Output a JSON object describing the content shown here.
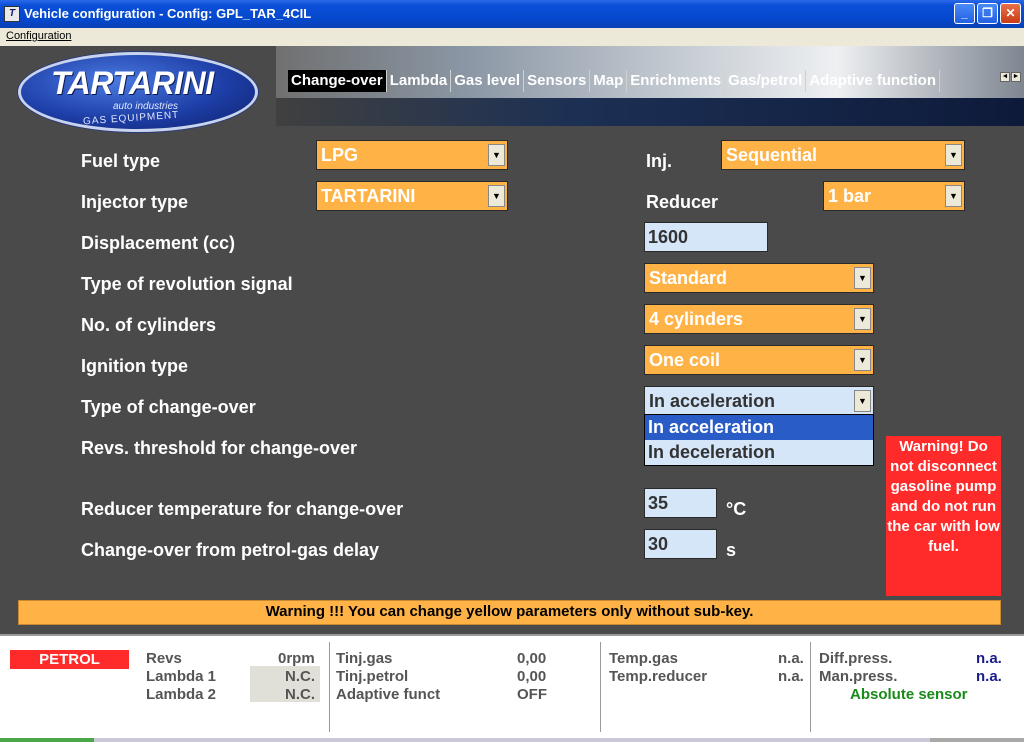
{
  "window": {
    "title": "Vehicle configuration - Config: GPL_TAR_4CIL",
    "app_icon": "tartarini-icon",
    "min_glyph": "_",
    "max_glyph": "❐",
    "close_glyph": "✕"
  },
  "menu": {
    "configuration": "Configuration"
  },
  "logo": {
    "brand": "TARTARINI",
    "sub1": "auto industries",
    "sub2": "GAS EQUIPMENT"
  },
  "tabs": [
    {
      "label": "Change-over",
      "active": true
    },
    {
      "label": "Lambda"
    },
    {
      "label": "Gas level"
    },
    {
      "label": "Sensors"
    },
    {
      "label": "Map"
    },
    {
      "label": "Enrichments"
    },
    {
      "label": "Gas/petrol"
    },
    {
      "label": "Adaptive function"
    }
  ],
  "tab_scroll": {
    "left": "◄",
    "right": "►"
  },
  "form": {
    "fuel_type": {
      "label": "Fuel type",
      "value": "LPG"
    },
    "injector_type": {
      "label": "Injector type",
      "value": "TARTARINI"
    },
    "inj": {
      "label": "Inj.",
      "value": "Sequential"
    },
    "reducer": {
      "label": "Reducer",
      "value": "1 bar"
    },
    "displacement": {
      "label": "Displacement (cc)",
      "value": "1600"
    },
    "rev_signal": {
      "label": "Type of revolution signal",
      "value": "Standard"
    },
    "cylinders": {
      "label": "No. of cylinders",
      "value": "4 cylinders"
    },
    "ignition": {
      "label": "Ignition type",
      "value": "One coil"
    },
    "changeover": {
      "label": "Type of change-over",
      "value": "In acceleration",
      "options": [
        "In acceleration",
        "In deceleration"
      ]
    },
    "revs_threshold": {
      "label": "Revs. threshold for change-over"
    },
    "reducer_temp": {
      "label": "Reducer temperature for change-over",
      "value": "35",
      "unit": "°C"
    },
    "delay": {
      "label": "Change-over from petrol-gas delay",
      "value": "30",
      "unit": "s"
    },
    "dropdown_glyph": "▼"
  },
  "warning_box": "Warning! Do not disconnect gasoline pump and do not run the car with low fuel.",
  "warning_bar": "Warning !!! You can change yellow parameters only without sub-key.",
  "status": {
    "mode": "PETROL",
    "revs_label": "Revs",
    "revs_value": "0rpm",
    "lambda1_label": "Lambda 1",
    "lambda1_value": "N.C.",
    "lambda2_label": "Lambda 2",
    "lambda2_value": "N.C.",
    "tinj_gas_label": "Tinj.gas",
    "tinj_gas_value": "0,00",
    "tinj_petrol_label": "Tinj.petrol",
    "tinj_petrol_value": "0,00",
    "adaptive_label": "Adaptive funct",
    "adaptive_value": "OFF",
    "temp_gas_label": "Temp.gas",
    "temp_gas_value": "n.a.",
    "temp_reducer_label": "Temp.reducer",
    "temp_reducer_value": "n.a.",
    "diff_press_label": "Diff.press.",
    "diff_press_value": "n.a.",
    "man_press_label": "Man.press.",
    "man_press_value": "n.a.",
    "absolute_sensor": "Absolute sensor"
  }
}
